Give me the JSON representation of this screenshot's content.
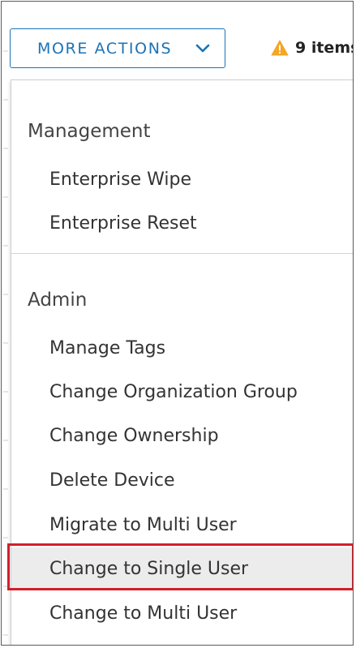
{
  "toolbar": {
    "more_actions_label": "MORE ACTIONS",
    "warning_text": "9 items"
  },
  "menu": {
    "sections": [
      {
        "header": "Management",
        "items": [
          "Enterprise Wipe",
          "Enterprise Reset"
        ]
      },
      {
        "header": "Admin",
        "items": [
          "Manage Tags",
          "Change Organization Group",
          "Change Ownership",
          "Delete Device",
          "Migrate to Multi User",
          "Change to Single User",
          "Change to Multi User"
        ]
      }
    ],
    "highlighted_item": "Change to Single User"
  },
  "colors": {
    "accent": "#1a73b8",
    "warning": "#f5a623",
    "highlight_border": "#d0202a",
    "hover_bg": "#ececec"
  },
  "icons": {
    "dropdown": "chevron-down-icon",
    "warning": "warning-triangle-icon"
  }
}
